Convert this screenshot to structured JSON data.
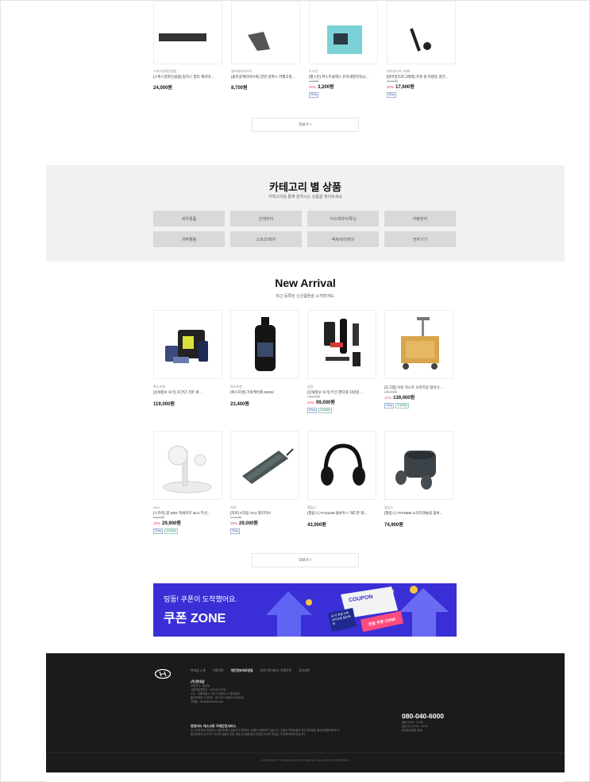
{
  "top_products": [
    {
      "brand": "스위스알파인클럽",
      "name": "[스위스알파인클럽] 탐허스 멀티 캐리어...",
      "original": "",
      "discount": "",
      "price": "24,000원",
      "badges": []
    },
    {
      "brand": "골프캐리어브로",
      "name": "[올포골캐리어브로] 양면 골퍼스 마켓고정...",
      "original": "",
      "discount": "",
      "price": "8,700원",
      "badges": []
    },
    {
      "brand": "오스칸",
      "name": "[펫스킨] 퍼스트클래스 유리세정마유(2...",
      "original": "4,000원",
      "discount": "20%",
      "price": "3,200원",
      "badges": [
        "3Day"
      ]
    },
    {
      "brand": "데이일리프그레택",
      "name": "[데이일리프그레택] 프렌 원 피렌동 충전...",
      "original": "25,000원",
      "discount": "30%",
      "price": "17,600원",
      "badges": [
        "3Day"
      ]
    }
  ],
  "top_more_label": "더보기 +",
  "category_section": {
    "title": "카테고리 별 상품",
    "subtitle": "카테고리를 통해 원하시는 상품을 찾아보세요",
    "items": [
      "세차용품",
      "인테리어",
      "익스테리어/튜닝",
      "차량관리",
      "차박캠핑",
      "스포츠/레저",
      "액세서리/편의",
      "전자기기"
    ]
  },
  "new_arrival": {
    "title": "New Arrival",
    "subtitle": "최근 등록된 신상품들을 소개할게요.",
    "products": [
      {
        "brand": "왁스프렌",
        "name": "[상세정보 보기] 초간단 기본 세...",
        "original": "",
        "discount": "",
        "price": "119,000원",
        "badges": [],
        "icon": "car-wash-kit-image"
      },
      {
        "brand": "왁스프렌",
        "name": "[왁스프렌] 가죽케어제 250ml",
        "original": "",
        "discount": "",
        "price": "23,400원",
        "badges": [],
        "icon": "leather-care-bottle-image"
      },
      {
        "brand": "상점",
        "name": "[상세정보 보기] 무선 핸디형 차량용 ...",
        "original": "129,000원",
        "discount": "23%",
        "price": "99,000원",
        "badges": [
          "3Day",
          "무료배송"
        ],
        "icon": "handheld-vacuum-image"
      },
      {
        "brand": "",
        "name": "[도그랩] 우린 허스트 오리지널 접이식 ...",
        "original": "168,000원",
        "discount": "17%",
        "price": "139,000원",
        "badges": [
          "3Day",
          "무료배송"
        ],
        "icon": "folding-cart-image"
      },
      {
        "brand": "ANV",
        "name": "[스카이] 팝 W04 맥세이프 3in1 무선...",
        "original": "36,000원",
        "discount": "19%",
        "price": "29,900원",
        "badges": [
          "3Day",
          "무료배송"
        ],
        "icon": "wireless-charger-image"
      },
      {
        "brand": "지로",
        "name": "[지로] C타입 7in1 멀티허브",
        "original": "33,000원",
        "discount": "18%",
        "price": "29,000원",
        "badges": [
          "3Day"
        ],
        "icon": "usb-hub-image"
      },
      {
        "brand": "필립스",
        "name": "[필립스] TAH1108 블루투스 헤드폰 화...",
        "original": "",
        "discount": "",
        "price": "43,000원",
        "badges": [],
        "icon": "headphones-image"
      },
      {
        "brand": "필립스",
        "name": "[필립스] TAT3508 노이즈캔슬링 블루...",
        "original": "",
        "discount": "",
        "price": "74,900원",
        "badges": [],
        "icon": "earbuds-image"
      }
    ]
  },
  "new_more_label": "더보기 +",
  "coupon_banner": {
    "subtitle": "띵동! 쿠폰이 도착했어요.",
    "title": "쿠폰 ZONE",
    "ticket_text": "COUPON",
    "tag1": "내 차 맞춤 인테리어상품 할인혜택",
    "tag2": "전용 쿠폰 ZONE"
  },
  "footer": {
    "links": [
      "현대샵 소개",
      "이용약관",
      "개인정보처리방침",
      "위치기반서비스 이용약관",
      "공지사항"
    ],
    "active_link": "개인정보처리방침",
    "company": "(주)현대샵",
    "company_lines": [
      "대표이사 : 홍길동",
      "사업자등록번호 : 123-45-12345",
      "주소 : 서울특별시 서초구 헌릉로 12 현대빌딩",
      "통신판매업 신고번호 : 제 2017-서울서초-0000호",
      "이메일 : shop@hyundai.com"
    ],
    "escrow_title": "현대카드 에스크로 구매안전서비스",
    "escrow_lines": [
      "본 사이트에서 판매되는 상품 중에는 입점사가 판매하는 상품이 포함되어 있습니다. 입점사 판매상품의 경우 현대샵은 통신판매중개자로서",
      "통신판매의 당사자가 아니며 상품의 주문, 배송 및 환불 등과 관련한 의무와 책임은 각 판매자에게 있습니다."
    ],
    "phone": "080-040-6000",
    "cs_lines": [
      "평일 09:00 - 17:00",
      "점심시간 12:00 - 13:00",
      "(토/일/공휴일 휴무)"
    ],
    "copyright": "COPYRIGHT © HYUNDAI MOTOR COMPANY. ALL RIGHTS RESERVED."
  },
  "colors": {
    "coupon_bg": "#3a2fd6",
    "footer_bg": "#1b1b1b",
    "discount": "#e8434b",
    "category_bg": "#f1f1f1"
  }
}
